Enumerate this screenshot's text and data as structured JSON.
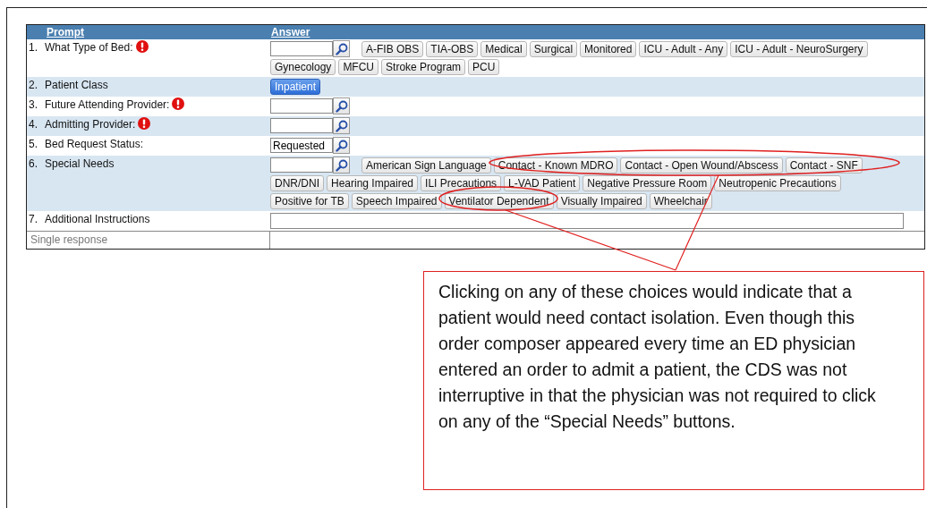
{
  "table": {
    "columns": [
      "Prompt",
      "Answer"
    ],
    "rows": [
      {
        "number": "1.",
        "prompt": "What Type of Bed:",
        "required": true,
        "answer": {
          "kind": "lookup",
          "options": [
            {
              "label": "A-FIB OBS",
              "selected": false
            },
            {
              "label": "TIA-OBS",
              "selected": false
            },
            {
              "label": "Medical",
              "selected": false
            },
            {
              "label": "Surgical",
              "selected": false
            },
            {
              "label": "Monitored",
              "selected": false
            },
            {
              "label": "ICU - Adult - Any",
              "selected": false
            },
            {
              "label": "ICU - Adult - NeuroSurgery",
              "selected": false
            },
            {
              "label": "Gynecology",
              "selected": false
            },
            {
              "label": "MFCU",
              "selected": false
            },
            {
              "label": "Stroke Program",
              "selected": false
            },
            {
              "label": "PCU",
              "selected": false
            }
          ]
        }
      },
      {
        "number": "2.",
        "prompt": "Patient Class",
        "required": false,
        "answer": {
          "kind": "choices",
          "options": [
            {
              "label": "Inpatient",
              "selected": true
            }
          ]
        }
      },
      {
        "number": "3.",
        "prompt": "Future Attending Provider:",
        "required": true,
        "answer": {
          "kind": "lookup"
        }
      },
      {
        "number": "4.",
        "prompt": "Admitting Provider:",
        "required": true,
        "answer": {
          "kind": "lookup"
        }
      },
      {
        "number": "5.",
        "prompt": "Bed Request Status:",
        "required": false,
        "answer": {
          "kind": "lookup",
          "value": "Requested"
        }
      },
      {
        "number": "6.",
        "prompt": "Special Needs",
        "required": false,
        "answer": {
          "kind": "lookup",
          "options": [
            {
              "label": "American Sign Language",
              "selected": false
            },
            {
              "label": "Contact - Known MDRO",
              "selected": false
            },
            {
              "label": "Contact - Open Wound/Abscess",
              "selected": false
            },
            {
              "label": "Contact - SNF",
              "selected": false
            },
            {
              "label": "DNR/DNI",
              "selected": false
            },
            {
              "label": "Hearing Impaired",
              "selected": false
            },
            {
              "label": "ILI Precautions",
              "selected": false
            },
            {
              "label": "L-VAD Patient",
              "selected": false
            },
            {
              "label": "Negative Pressure Room",
              "selected": false
            },
            {
              "label": "Neutropenic Precautions",
              "selected": false
            },
            {
              "label": "Positive for TB",
              "selected": false
            },
            {
              "label": "Speech Impaired",
              "selected": false
            },
            {
              "label": "Ventilator Dependent",
              "selected": false
            },
            {
              "label": "Visually Impaired",
              "selected": false
            },
            {
              "label": "Wheelchair",
              "selected": false
            }
          ]
        }
      },
      {
        "number": "7.",
        "prompt": "Additional Instructions",
        "required": false,
        "answer": {
          "kind": "text"
        }
      }
    ],
    "footer": "Single response"
  },
  "callout": "Clicking on any of these choices would indicate that a patient would need contact isolation.  Even though this order composer appeared every time an ED physician entered an order to admit a patient, the CDS was not interruptive in that the physician was not required to click on any of the “Special Needs” buttons."
}
